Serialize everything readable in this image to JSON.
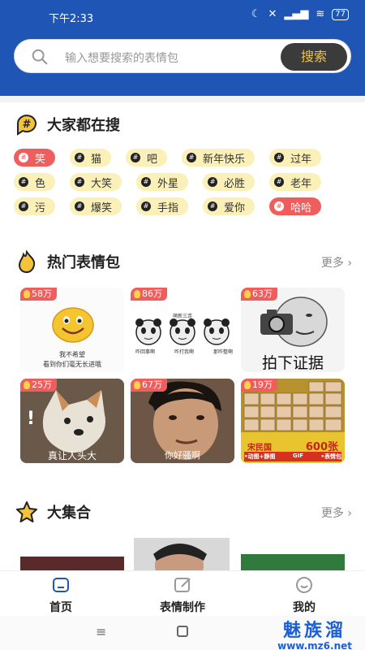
{
  "status_bar": {
    "time": "下午2:33",
    "battery": "77"
  },
  "search": {
    "placeholder": "输入想要搜索的表情包",
    "button_label": "搜索"
  },
  "trending": {
    "title": "大家都在搜",
    "tags": [
      [
        {
          "label": "笑",
          "hot": true
        },
        {
          "label": "猫"
        },
        {
          "label": "吧"
        },
        {
          "label": "新年快乐"
        },
        {
          "label": "过年"
        }
      ],
      [
        {
          "label": "色"
        },
        {
          "label": "大笑"
        },
        {
          "label": "外星"
        },
        {
          "label": "必胜"
        },
        {
          "label": "老年"
        }
      ],
      [
        {
          "label": "污"
        },
        {
          "label": "爆笑"
        },
        {
          "label": "手指"
        },
        {
          "label": "爱你"
        },
        {
          "label": "哈哈",
          "hot": true
        }
      ]
    ]
  },
  "hot_packs": {
    "title": "热门表情包",
    "more_label": "更多 ›",
    "cards": [
      {
        "count": "58万",
        "caption1": "我不希望",
        "caption2": "看到你们毫无长进哦"
      },
      {
        "count": "86万",
        "top_caption": "萌新三连",
        "captions": [
          "咋回事啊",
          "咋打我啊",
          "那咋整啊"
        ]
      },
      {
        "count": "63万",
        "caption": "拍下证据"
      },
      {
        "count": "25万",
        "caption": "真让人头大"
      },
      {
        "count": "67万",
        "caption": "你好骚啊"
      },
      {
        "count": "19万",
        "banner": "宋民国",
        "banner_count": "600张",
        "banner_sub1": "•动图+静图",
        "banner_sub2": "GIF",
        "banner_sub3": "•表情包"
      }
    ]
  },
  "collection": {
    "title": "大集合",
    "more_label": "更多 ›"
  },
  "nav": {
    "home": "首页",
    "create": "表情制作",
    "mine": "我的"
  },
  "watermark": {
    "name": "魅族溜",
    "url": "www.mz6.net"
  }
}
